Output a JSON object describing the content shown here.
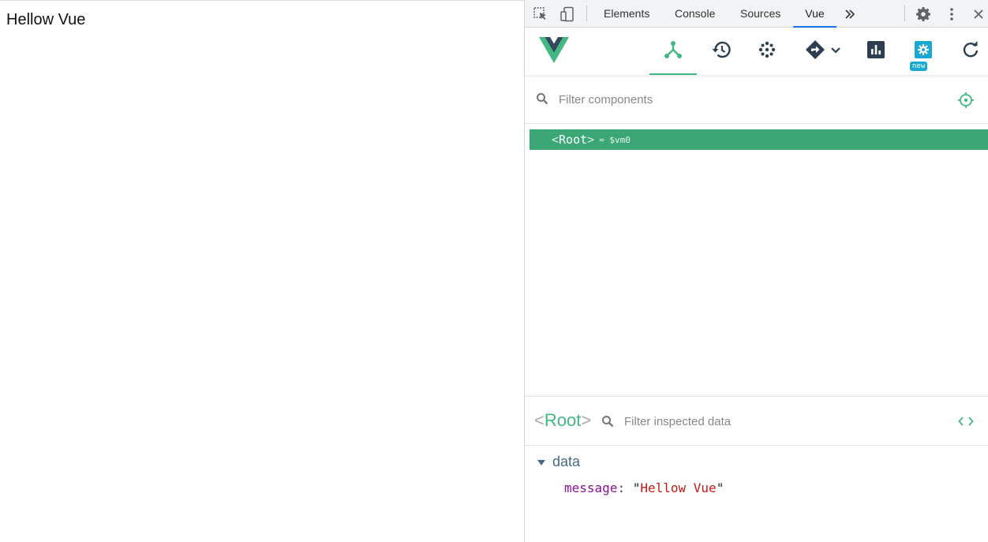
{
  "page": {
    "text": "Hellow Vue"
  },
  "devtools": {
    "tabs": [
      "Elements",
      "Console",
      "Sources",
      "Vue"
    ],
    "active_tab": "Vue"
  },
  "vue": {
    "toolbar": {
      "new_badge": "new",
      "tools": [
        "components-icon",
        "history-icon",
        "vuex-icon",
        "events-icon",
        "performance-icon",
        "settings-icon",
        "refresh-icon"
      ]
    },
    "filter_components": {
      "placeholder": "Filter components"
    },
    "tree": {
      "root_bracket_open": "<",
      "root_name": "Root",
      "root_bracket_close": ">",
      "root_ref": "= $vm0"
    },
    "inspector": {
      "bracket_open": "<",
      "name": "Root",
      "bracket_close": ">",
      "filter_placeholder": "Filter inspected data",
      "section": "data",
      "prop_key": "message",
      "prop_colon": ":",
      "prop_quote": "\"",
      "prop_value": "Hellow Vue"
    }
  },
  "colors": {
    "vue_green": "#42b983",
    "selected_row": "#3ba776",
    "active_tab_underline": "#1a73e8",
    "badge": "#1aa8d4",
    "string_value": "#c41a16",
    "key": "#881391"
  }
}
